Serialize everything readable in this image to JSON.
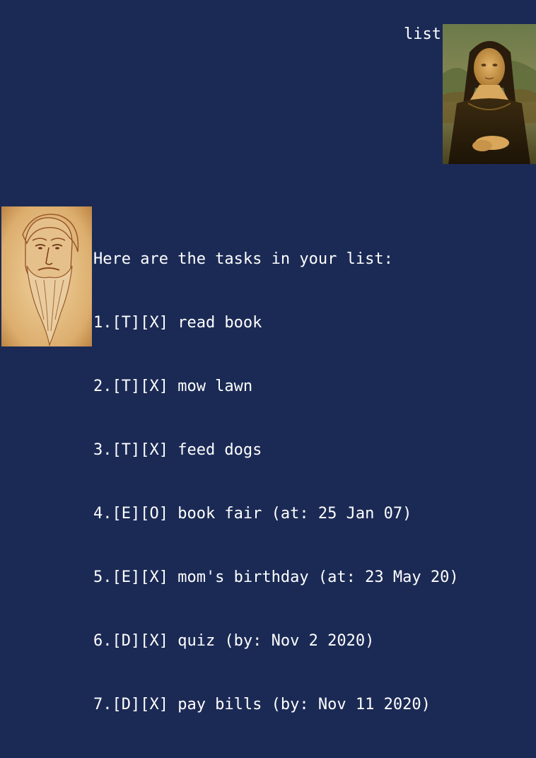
{
  "user_message": {
    "text": "list",
    "avatar_icon": "mona-lisa-portrait-avatar"
  },
  "bot_message": {
    "avatar_icon": "leonardo-self-portrait-avatar",
    "header": "Here are the tasks in your list:",
    "tasks": [
      "1.[T][X] read book",
      "2.[T][X] mow lawn",
      "3.[T][X] feed dogs",
      "4.[E][O] book fair (at: 25 Jan 07)",
      "5.[E][X] mom's birthday (at: 23 May 20)",
      "6.[D][X] quiz (by: Nov 2 2020)",
      "7.[D][X] pay bills (by: Nov 11 2020)"
    ]
  },
  "colors": {
    "background": "#1b2a55",
    "text": "#ffffff"
  }
}
